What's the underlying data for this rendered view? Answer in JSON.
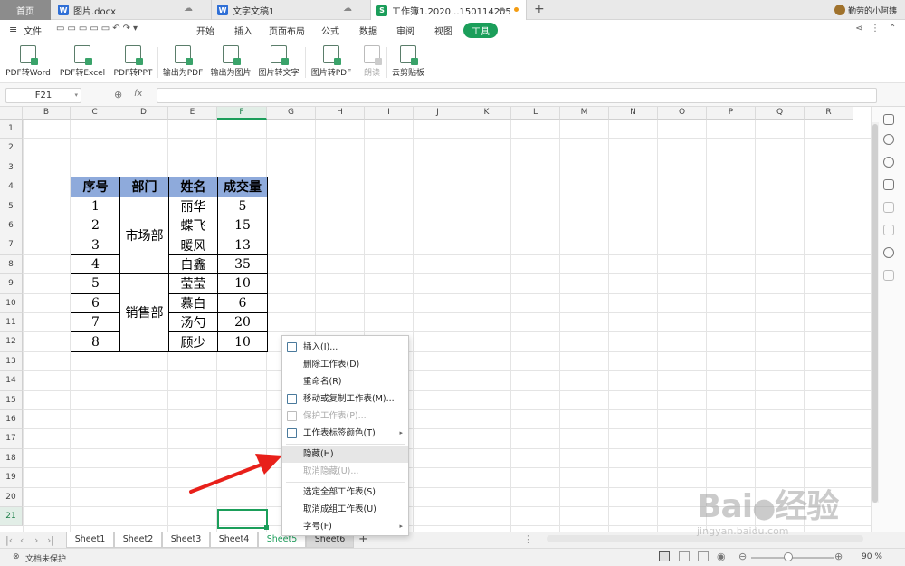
{
  "tabs": {
    "home": "首页",
    "doc1": "图片.docx",
    "doc2": "文字文稿1",
    "doc3": "工作簿1.2020...150114205",
    "add": "+",
    "user": "勤劳的小阿姨"
  },
  "menu": {
    "file": "文件",
    "items": [
      "开始",
      "插入",
      "页面布局",
      "公式",
      "数据",
      "审阅",
      "视图"
    ],
    "active": "工具"
  },
  "ribbon": [
    "PDF转Word",
    "PDF转Excel",
    "PDF转PPT",
    "输出为PDF",
    "输出为图片",
    "图片转文字",
    "图片转PDF",
    "朗读",
    "云剪贴板"
  ],
  "formula": {
    "cell": "F21",
    "fx": "fx"
  },
  "columns": [
    "B",
    "C",
    "D",
    "E",
    "F",
    "G",
    "H",
    "I",
    "J",
    "K",
    "L",
    "M",
    "N",
    "O",
    "P",
    "Q",
    "R"
  ],
  "rows": [
    "1",
    "2",
    "3",
    "4",
    "5",
    "6",
    "7",
    "8",
    "9",
    "10",
    "11",
    "12",
    "13",
    "14",
    "15",
    "16",
    "17",
    "18",
    "19",
    "20",
    "21"
  ],
  "table": {
    "headers": [
      "序号",
      "部门",
      "姓名",
      "成交量"
    ],
    "ids": [
      "1",
      "2",
      "3",
      "4",
      "5",
      "6",
      "7",
      "8"
    ],
    "depts": [
      "市场部",
      "销售部"
    ],
    "names": [
      "丽华",
      "蝶飞",
      "暖风",
      "白鑫",
      "莹莹",
      "慕白",
      "汤勺",
      "顾少"
    ],
    "volumes": [
      "5",
      "15",
      "13",
      "35",
      "10",
      "6",
      "20",
      "10"
    ]
  },
  "context_menu": {
    "items": [
      "插入(I)...",
      "删除工作表(D)",
      "重命名(R)",
      "移动或复制工作表(M)...",
      "保护工作表(P)...",
      "工作表标签颜色(T)",
      "隐藏(H)",
      "取消隐藏(U)...",
      "选定全部工作表(S)",
      "取消成组工作表(U)",
      "字号(F)"
    ]
  },
  "sheets": [
    "Sheet1",
    "Sheet2",
    "Sheet3",
    "Sheet4",
    "Sheet5",
    "Sheet6"
  ],
  "status": {
    "protect": "文档未保护",
    "zoom": "90 %"
  },
  "watermark": {
    "brand": "Bai",
    "brand2": "经验",
    "url": "jingyan.baidu.com"
  },
  "colors": {
    "accent": "#1b9e5a",
    "header_fill": "#8eaadb",
    "arrow": "#e8201a"
  }
}
